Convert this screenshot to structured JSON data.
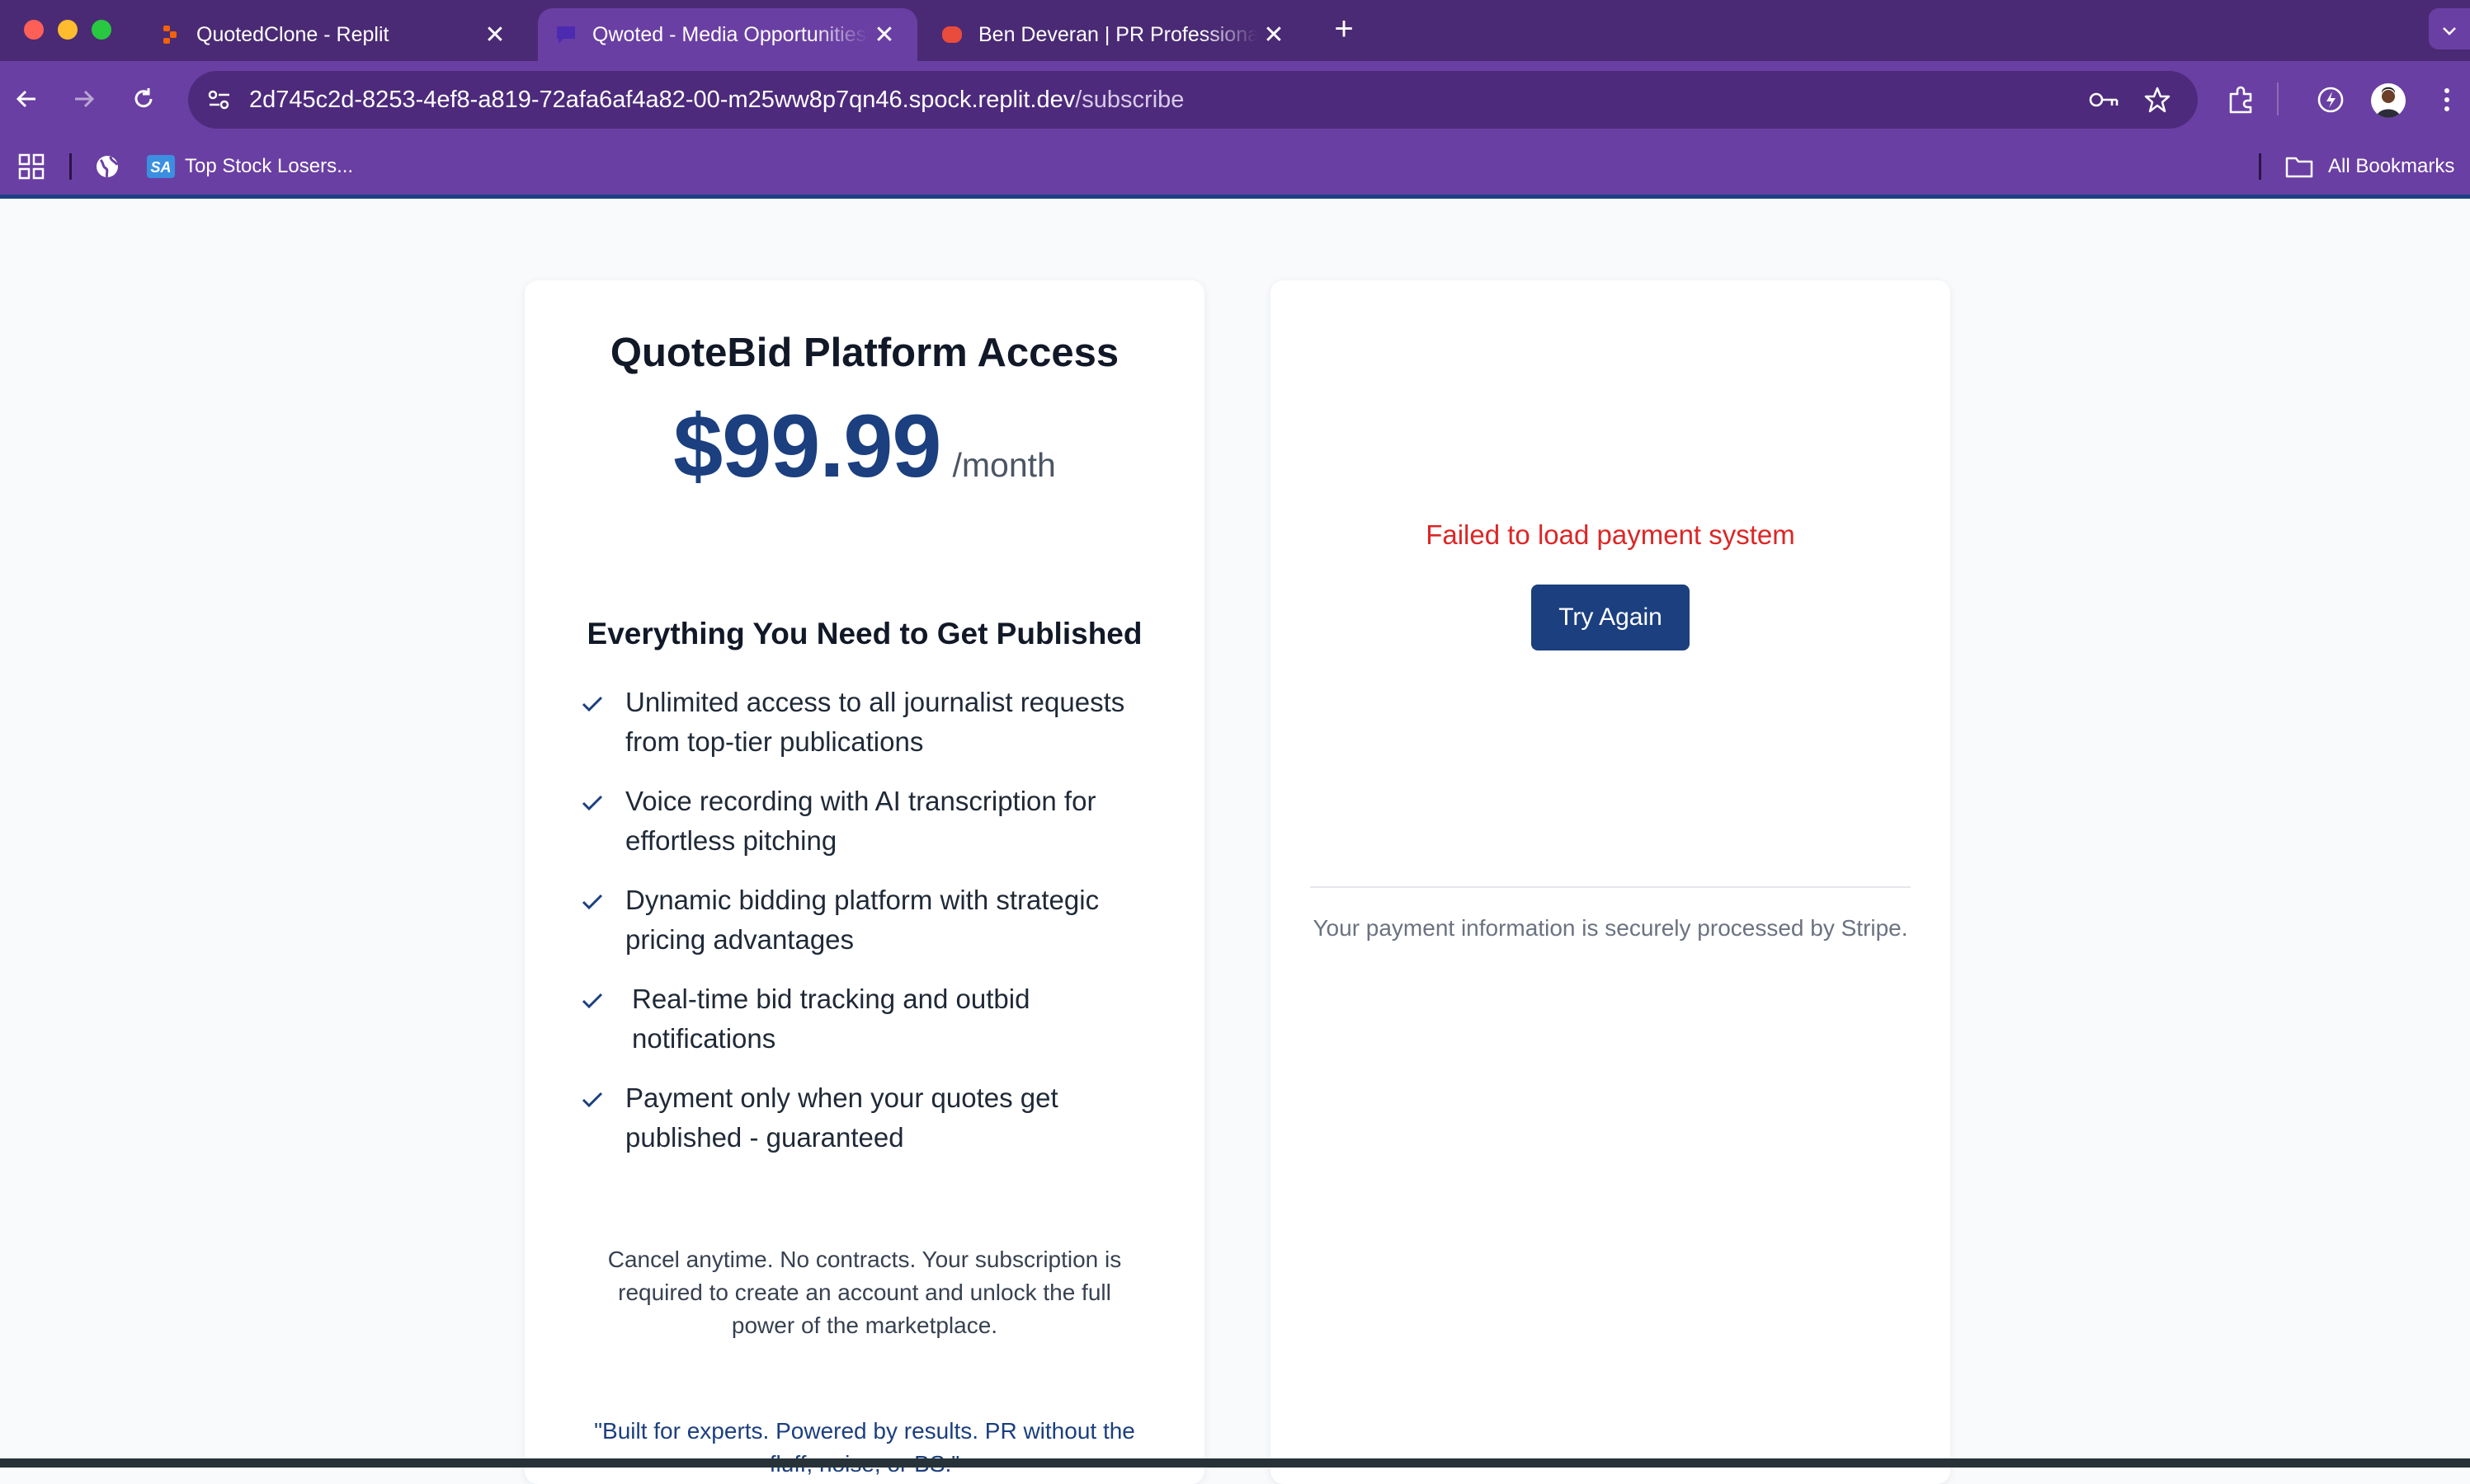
{
  "browser": {
    "tabs": [
      {
        "title": "QuotedClone - Replit",
        "active": false
      },
      {
        "title": "Qwoted - Media Opportunities",
        "active": true
      },
      {
        "title": "Ben Deveran | PR Professional",
        "active": false
      }
    ],
    "address_bar": {
      "host": "2d745c2d-8253-4ef8-a819-72afa6af4a82-00-m25ww8p7qn46.spock.replit.dev",
      "path": "/subscribe"
    },
    "bookmarks": {
      "sa_label": "Top Stock Losers...",
      "all_bookmarks": "All Bookmarks"
    },
    "colors": {
      "frame": "#4a2a74",
      "toolbar": "#6a3fa3"
    }
  },
  "plan": {
    "title": "QuoteBid Platform Access",
    "price": "$99.99",
    "period": "/month",
    "features_title": "Everything You Need to Get Published",
    "features": [
      "Unlimited access to all journalist requests from top-tier publications",
      "Voice recording with AI transcription for effortless pitching",
      "Dynamic bidding platform with strategic pricing advantages",
      "Real-time bid tracking and outbid notifications",
      "Payment only when your quotes get published - guaranteed"
    ],
    "cancel_note": "Cancel anytime. No contracts. Your subscription is required to create an account and unlock the full power of the marketplace.",
    "tagline": "\"Built for experts. Powered by results. PR without the fluff, noise, or BS.\""
  },
  "payment": {
    "error": "Failed to load payment system",
    "retry_label": "Try Again",
    "secure_note": "Your payment information is securely processed by Stripe."
  },
  "colors": {
    "brand": "#1b3f7f",
    "error": "#dc2626",
    "check": "#1b3f7f"
  }
}
